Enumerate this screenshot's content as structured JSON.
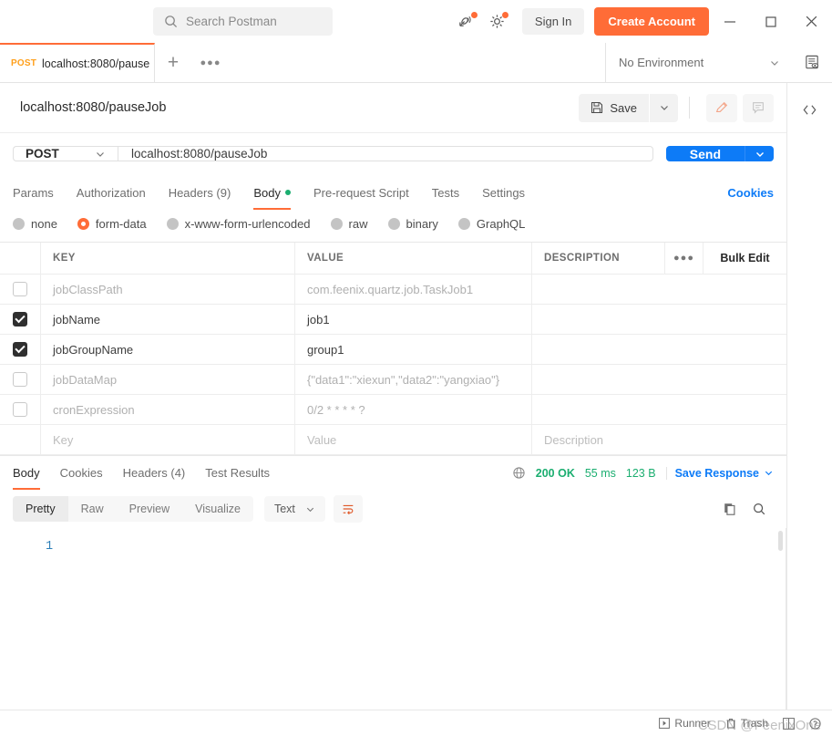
{
  "topbar": {
    "search_placeholder": "Search Postman",
    "search_icon": "search-icon",
    "satellite_icon": "satellite-icon",
    "gear_icon": "gear-icon",
    "sign_in": "Sign In",
    "create_account": "Create Account",
    "minimize": "—",
    "maximize": "□",
    "close": "✕"
  },
  "tabstrip": {
    "request_tab": {
      "method": "POST",
      "name": "localhost:8080/pause",
      "unsaved": true
    },
    "new_tab_icon": "plus-icon",
    "more_icon": "ellipsis-icon",
    "environment": "No Environment",
    "env_caret_icon": "chevron-down-icon",
    "env_eye_icon": "environment-quick-look-icon"
  },
  "request": {
    "name": "localhost:8080/pauseJob",
    "save_label": "Save",
    "save_icon": "floppy-disk-icon",
    "save_caret_icon": "chevron-down-icon",
    "edit_icon": "pencil-icon",
    "comment_icon": "comment-icon",
    "method": "POST",
    "method_caret_icon": "chevron-down-icon",
    "url": "localhost:8080/pauseJob",
    "send_label": "Send",
    "send_caret_icon": "chevron-down-icon"
  },
  "request_tabs": {
    "items": [
      {
        "label": "Params",
        "active": false,
        "dot": false
      },
      {
        "label": "Authorization",
        "active": false,
        "dot": false
      },
      {
        "label": "Headers (9)",
        "active": false,
        "dot": false
      },
      {
        "label": "Body",
        "active": true,
        "dot": true
      },
      {
        "label": "Pre-request Script",
        "active": false,
        "dot": false
      },
      {
        "label": "Tests",
        "active": false,
        "dot": false
      },
      {
        "label": "Settings",
        "active": false,
        "dot": false
      }
    ],
    "cookies": "Cookies"
  },
  "body_types": [
    {
      "label": "none",
      "selected": false
    },
    {
      "label": "form-data",
      "selected": true
    },
    {
      "label": "x-www-form-urlencoded",
      "selected": false
    },
    {
      "label": "raw",
      "selected": false
    },
    {
      "label": "binary",
      "selected": false
    },
    {
      "label": "GraphQL",
      "selected": false
    }
  ],
  "kv_table": {
    "headers": {
      "key": "KEY",
      "value": "VALUE",
      "description": "DESCRIPTION",
      "more_icon": "ellipsis-icon",
      "bulk_edit": "Bulk Edit"
    },
    "rows": [
      {
        "checked": false,
        "key": "jobClassPath",
        "value": "com.feenix.quartz.job.TaskJob1",
        "description": "",
        "muted": true
      },
      {
        "checked": true,
        "key": "jobName",
        "value": "job1",
        "description": "",
        "muted": false
      },
      {
        "checked": true,
        "key": "jobGroupName",
        "value": "group1",
        "description": "",
        "muted": false
      },
      {
        "checked": false,
        "key": "jobDataMap",
        "value": "{\"data1\":\"xiexun\",\"data2\":\"yangxiao\"}",
        "description": "",
        "muted": true
      },
      {
        "checked": false,
        "key": "cronExpression",
        "value": "0/2 * * * * ?",
        "description": "",
        "muted": true
      }
    ],
    "placeholder_row": {
      "key": "Key",
      "value": "Value",
      "description": "Description"
    }
  },
  "response": {
    "tabs": [
      {
        "label": "Body",
        "active": true
      },
      {
        "label": "Cookies",
        "active": false
      },
      {
        "label": "Headers (4)",
        "active": false
      },
      {
        "label": "Test Results",
        "active": false
      }
    ],
    "globe_icon": "globe-icon",
    "status": "200 OK",
    "time": "55 ms",
    "size": "123 B",
    "save_response": "Save Response",
    "save_response_caret_icon": "chevron-down-icon",
    "view_modes": [
      {
        "label": "Pretty",
        "active": true
      },
      {
        "label": "Raw",
        "active": false
      },
      {
        "label": "Preview",
        "active": false
      },
      {
        "label": "Visualize",
        "active": false
      }
    ],
    "format": "Text",
    "format_caret_icon": "chevron-down-icon",
    "wrap_icon": "word-wrap-icon",
    "copy_icon": "copy-icon",
    "search_icon": "search-icon",
    "line_number": "1",
    "content": ""
  },
  "statusbar": {
    "runner": "Runner",
    "runner_icon": "runner-icon",
    "trash": "Trash",
    "trash_icon": "trash-icon",
    "layout_icon": "layout-icon",
    "help_icon": "help-icon",
    "watermark": "CSDN @FeenixOne"
  },
  "right_rail": {
    "code_icon": "code-icon"
  },
  "colors": {
    "accent": "#ff6c37",
    "send_blue": "#0d7bf7",
    "status_green": "#1bae70",
    "link_blue": "#0d7bf7"
  }
}
